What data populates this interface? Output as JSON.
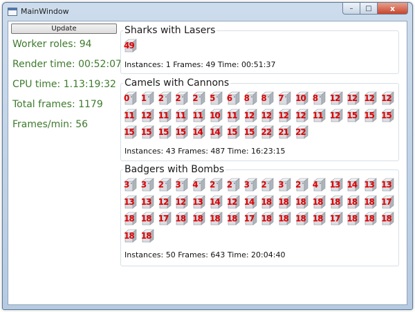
{
  "window": {
    "title": "MainWindow",
    "controls": {
      "minimize": "–",
      "maximize": "□",
      "close": "x"
    }
  },
  "sidebar": {
    "update_label": "Update",
    "stats": [
      "Worker roles: 94",
      "Render time: 00:52:07",
      "CPU time: 1.13:19:32",
      "Total frames: 1179",
      "Frames/min: 56"
    ]
  },
  "groups": [
    {
      "title": "Sharks with Lasers",
      "tiles": [
        "49"
      ],
      "info": "Instances: 1 Frames: 49 Time: 00:51:37"
    },
    {
      "title": "Camels with Cannons",
      "tiles": [
        "0",
        "1",
        "2",
        "2",
        "2",
        "5",
        "6",
        "8",
        "8",
        "7",
        "10",
        "8",
        "12",
        "12",
        "12",
        "12",
        "11",
        "12",
        "11",
        "11",
        "11",
        "10",
        "11",
        "12",
        "12",
        "12",
        "12",
        "11",
        "12",
        "15",
        "15",
        "15",
        "15",
        "15",
        "15",
        "15",
        "14",
        "14",
        "15",
        "15",
        "22",
        "21",
        "22"
      ],
      "info": "Instances: 43 Frames: 487 Time: 16:23:15"
    },
    {
      "title": "Badgers with Bombs",
      "tiles": [
        "3",
        "3",
        "2",
        "3",
        "4",
        "2",
        "2",
        "3",
        "2",
        "3",
        "2",
        "4",
        "13",
        "14",
        "13",
        "13",
        "13",
        "13",
        "12",
        "12",
        "13",
        "14",
        "12",
        "14",
        "18",
        "18",
        "18",
        "18",
        "18",
        "18",
        "18",
        "17",
        "18",
        "18",
        "17",
        "18",
        "18",
        "18",
        "18",
        "17",
        "18",
        "18",
        "18",
        "18",
        "17",
        "18",
        "18",
        "18",
        "18",
        "18"
      ],
      "info": "Instances: 50 Frames: 643 Time: 20:04:40"
    }
  ],
  "colors": {
    "stat_text": "#3d7a2c",
    "tile_number": "#e00000"
  }
}
